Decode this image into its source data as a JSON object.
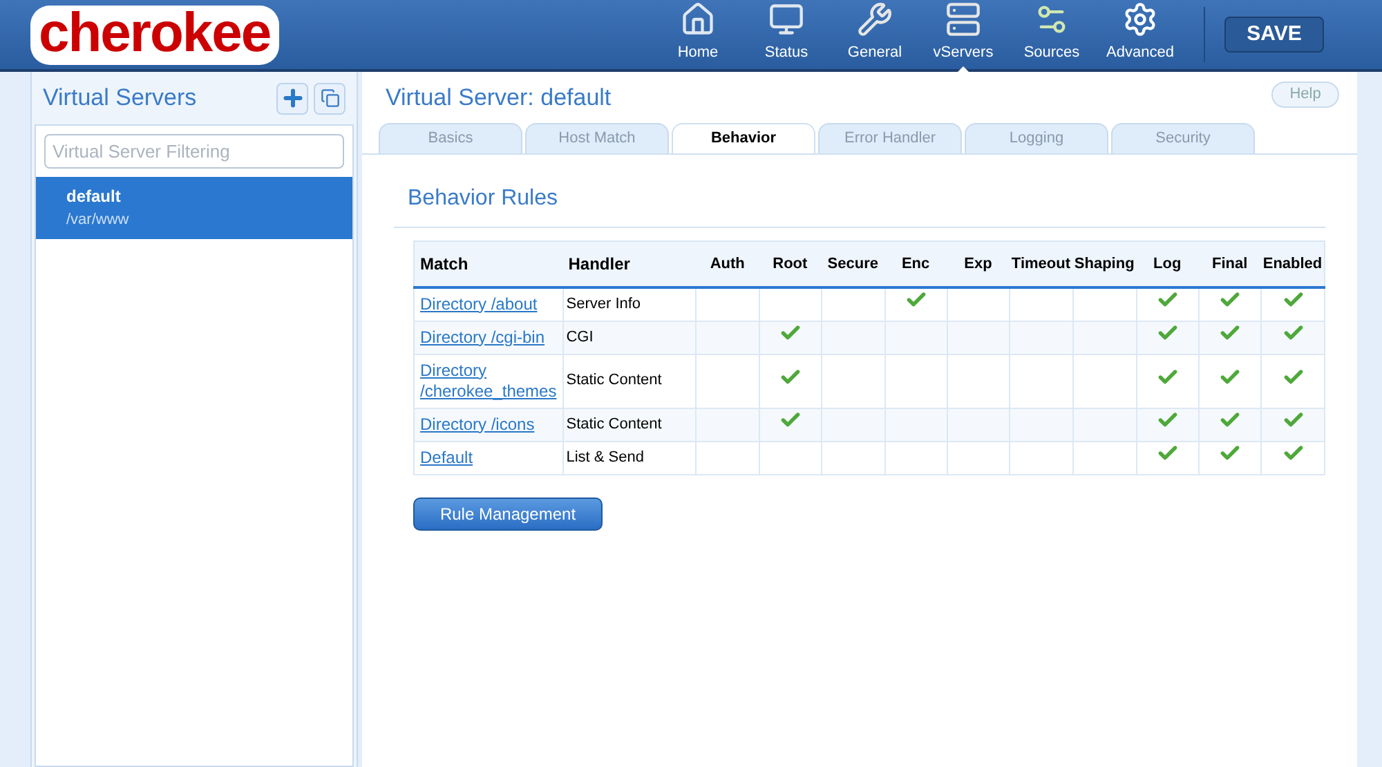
{
  "logo": "cherokee",
  "nav": [
    {
      "label": "Home",
      "selected": false
    },
    {
      "label": "Status",
      "selected": false
    },
    {
      "label": "General",
      "selected": false
    },
    {
      "label": "vServers",
      "selected": true
    },
    {
      "label": "Sources",
      "selected": false
    },
    {
      "label": "Advanced",
      "selected": false
    }
  ],
  "save_button": "SAVE",
  "sidebar": {
    "title": "Virtual Servers",
    "filter": {
      "placeholder": "Virtual Server Filtering"
    },
    "items": [
      {
        "name": "default",
        "path": "/var/www",
        "selected": true
      }
    ]
  },
  "main": {
    "title": "Virtual Server: default",
    "help": "Help",
    "tabs": [
      {
        "label": "Basics",
        "selected": false
      },
      {
        "label": "Host Match",
        "selected": false
      },
      {
        "label": "Behavior",
        "selected": true
      },
      {
        "label": "Error Handler",
        "selected": false
      },
      {
        "label": "Logging",
        "selected": false
      },
      {
        "label": "Security",
        "selected": false
      }
    ],
    "section_title": "Behavior Rules",
    "table": {
      "columns": [
        "Match",
        "Handler",
        "Auth",
        "Root",
        "Secure",
        "Enc",
        "Exp",
        "Timeout",
        "Shaping",
        "Log",
        "Final",
        "Enabled"
      ],
      "rows": [
        {
          "match": "Directory /about",
          "handler": "Server Info",
          "flags": [
            false,
            false,
            false,
            true,
            false,
            false,
            false,
            true,
            true,
            true
          ]
        },
        {
          "match": "Directory /cgi-bin",
          "handler": "CGI",
          "flags": [
            false,
            true,
            false,
            false,
            false,
            false,
            false,
            true,
            true,
            true
          ]
        },
        {
          "match": "Directory /cherokee_themes",
          "handler": "Static Content",
          "flags": [
            false,
            true,
            false,
            false,
            false,
            false,
            false,
            true,
            true,
            true
          ]
        },
        {
          "match": "Directory /icons",
          "handler": "Static Content",
          "flags": [
            false,
            true,
            false,
            false,
            false,
            false,
            false,
            true,
            true,
            true
          ]
        },
        {
          "match": "Default",
          "handler": "List & Send",
          "flags": [
            false,
            false,
            false,
            false,
            false,
            false,
            false,
            true,
            true,
            true
          ]
        }
      ]
    },
    "rule_button": "Rule Management"
  }
}
